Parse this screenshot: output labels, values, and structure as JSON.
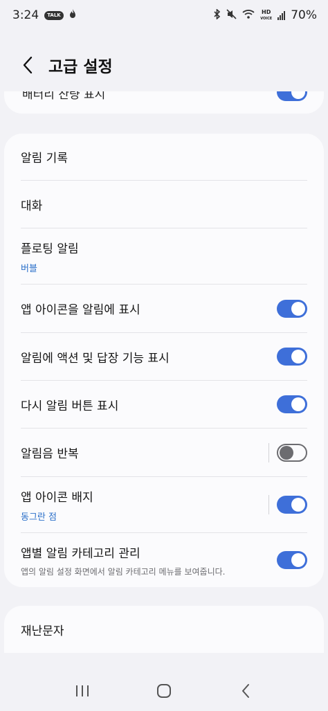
{
  "status_bar": {
    "time": "3:24",
    "talk_badge": "TALK",
    "hd_top": "HD",
    "hd_bottom": "VOICE",
    "battery": "70%"
  },
  "header": {
    "title": "고급 설정"
  },
  "top_card": {
    "partial_label": "배터리 잔량 표시",
    "toggle_on": true
  },
  "settings": {
    "items": [
      {
        "label": "알림 기록"
      },
      {
        "label": "대화"
      },
      {
        "label": "플로팅 알림",
        "sub": "버블"
      },
      {
        "label": "앱 아이콘을 알림에 표시",
        "toggle": "on"
      },
      {
        "label": "알림에 액션 및 답장 기능 표시",
        "toggle": "on"
      },
      {
        "label": "다시 알림 버튼 표시",
        "toggle": "on"
      },
      {
        "label": "알림음 반복",
        "toggle": "off"
      },
      {
        "label": "앱 아이콘 배지",
        "sub": "동그란 점",
        "toggle": "on"
      },
      {
        "label": "앱별 알림 카테고리 관리",
        "sub": "앱의 알림 설정 화면에서 알림 카테고리 메뉴를 보여줍니다.",
        "toggle": "on"
      }
    ]
  },
  "bottom_card": {
    "label": "재난문자"
  },
  "colors": {
    "accent": "#3e6fd9",
    "sub_text": "#2a6fc9",
    "background": "#f2f2f6",
    "card": "#fbfbfd"
  },
  "nav": {
    "recents": "recents-icon",
    "home": "home-icon",
    "back": "back-icon"
  }
}
